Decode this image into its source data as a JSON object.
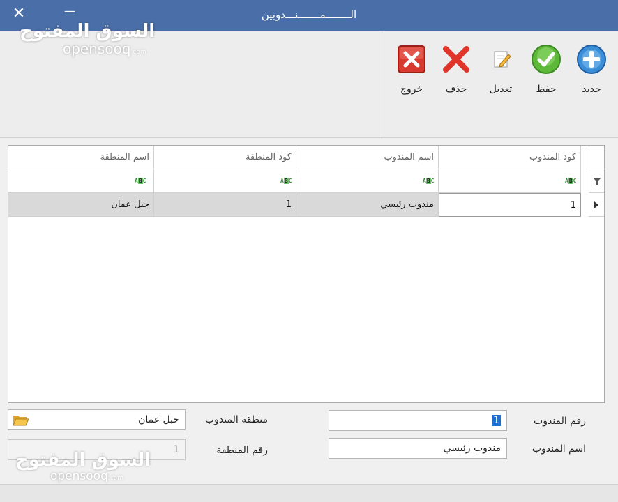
{
  "window": {
    "title": "الــــــــمـــــــنـــدوبين",
    "close_symbol": "✕",
    "minimize_symbol": "—"
  },
  "watermark": {
    "arabic": "السوق المفتوح",
    "english": "opensooq",
    "suffix": ".com"
  },
  "toolbar": {
    "new_label": "جديد",
    "save_label": "حفظ",
    "edit_label": "تعديل",
    "delete_label": "حذف",
    "exit_label": "خروج",
    "colors": {
      "new": "#3a8fd8",
      "save": "#5db83a",
      "delete": "#e0352b",
      "exit": "#d93a2f"
    }
  },
  "grid": {
    "columns": [
      "كود المندوب",
      "اسم المندوب",
      "كود المنطقة",
      "اسم المنطقة"
    ],
    "filter_icon": "ABC",
    "rows": [
      {
        "rep_code": "1",
        "rep_name": "مندوب رئيسي",
        "region_code": "1",
        "region_name": "جبل عمان"
      }
    ]
  },
  "form": {
    "rep_number_label": "رقم المندوب",
    "rep_number_value": "1",
    "rep_name_label": "اسم المندوب",
    "rep_name_value": "مندوب رئيسي",
    "rep_region_label": "منطقة المندوب",
    "rep_region_value": "جبل عمان",
    "region_number_label": "رقم المنطقة",
    "region_number_value": "1"
  }
}
